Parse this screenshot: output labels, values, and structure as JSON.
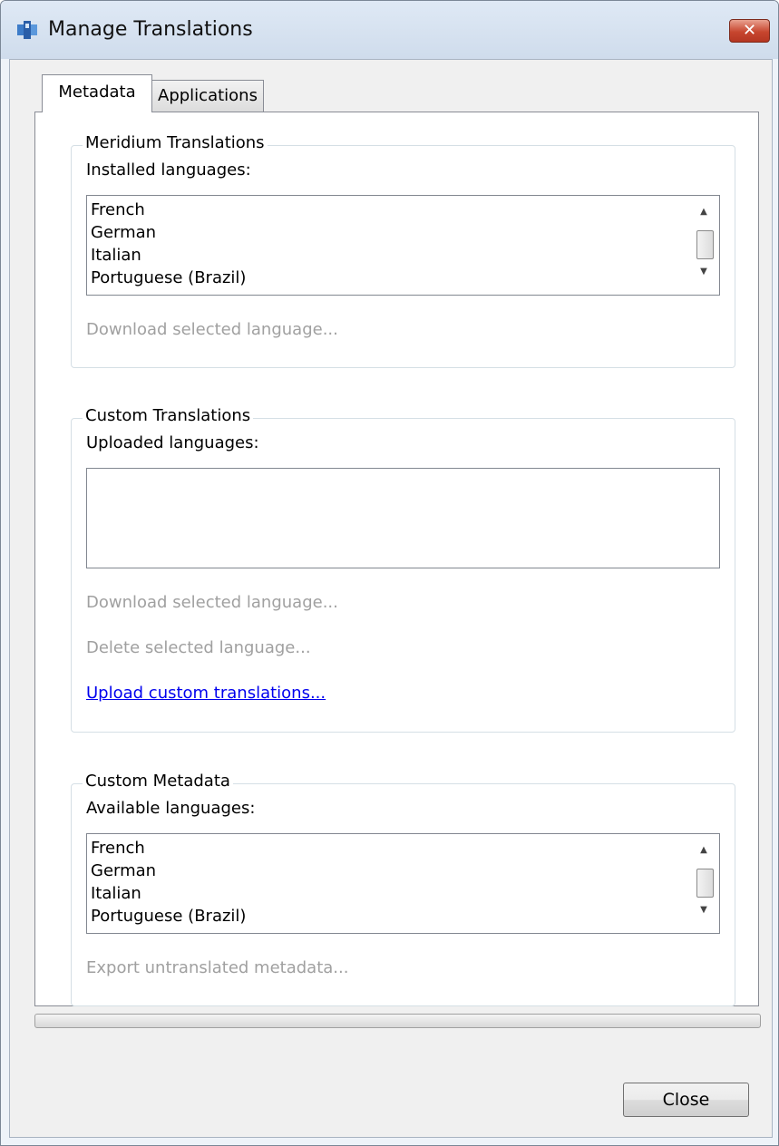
{
  "window": {
    "title": "Manage Translations",
    "close_glyph": "✕"
  },
  "tabs": [
    {
      "label": "Metadata",
      "selected": true
    },
    {
      "label": "Applications",
      "selected": false
    }
  ],
  "meridium": {
    "group_title": "Meridium Translations",
    "list_label": "Installed languages:",
    "items": [
      "French",
      "German",
      "Italian",
      "Portuguese (Brazil)"
    ],
    "download_label": "Download selected language..."
  },
  "custom": {
    "group_title": "Custom Translations",
    "list_label": "Uploaded languages:",
    "items": [],
    "download_label": "Download selected language...",
    "delete_label": "Delete selected language...",
    "upload_label": "Upload custom translations..."
  },
  "metadata": {
    "group_title": "Custom Metadata",
    "list_label": "Available languages:",
    "items": [
      "French",
      "German",
      "Italian",
      "Portuguese (Brazil)"
    ],
    "export_label": "Export untranslated metadata..."
  },
  "footer": {
    "close_label": "Close"
  },
  "icons": {
    "app": "app-cubes-icon",
    "scroll_up": "▲",
    "scroll_down": "▼"
  },
  "colors": {
    "link": "#0000ee",
    "disabled": "#a0a0a0",
    "close_button": "#c7462f"
  }
}
